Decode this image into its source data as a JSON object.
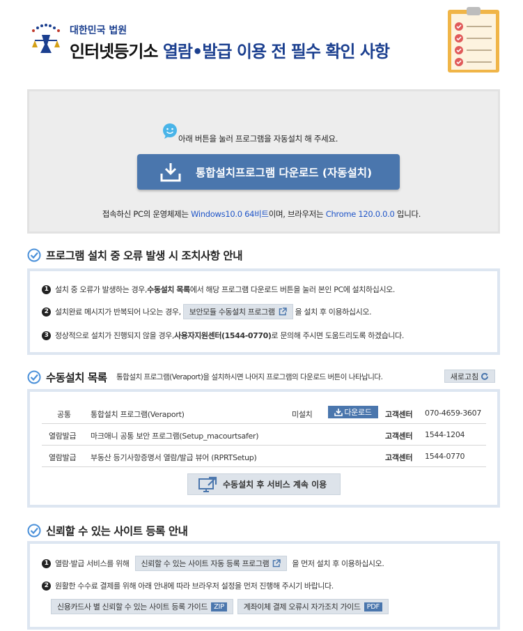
{
  "header": {
    "court": "대한민국 법원",
    "title_a": "인터넷등기소 ",
    "title_b": "열람•발급 이용 전 필수 확인 사항"
  },
  "install": {
    "hint": "아래 버튼을 눌러 프로그램을 자동설치 해 주세요.",
    "button": "통합설치프로그램 다운로드 (자동설치)",
    "os_a": "접속하신 PC의 운영체제는 ",
    "os": "Windows10.0 64비트",
    "os_b": "이며, 브라우저는 ",
    "browser": "Chrome 120.0.0.0",
    "os_c": " 입니다."
  },
  "errors": {
    "heading": "프로그램 설치 중 오류 발생 시 조치사항 안내",
    "s1_a": "설치 중 오류가 발생하는 경우, ",
    "s1_b": "수동설치 목록",
    "s1_c": "에서 해당 프로그램 다운로드 버튼을 눌러 본인 PC에 설치하십시오.",
    "s2_a": "설치완료 메시지가 반복되어 나오는 경우,",
    "s2_btn": "보안모듈 수동설치 프로그램",
    "s2_b": "을 설치 후 이용하십시오.",
    "s3_a": "정상적으로 설치가 진행되지 않을 경우, ",
    "s3_b": "사용자지원센터(1544-0770)",
    "s3_c": "로 문의해 주시면 도움드리도록 하겠습니다."
  },
  "manual": {
    "heading": "수동설치 목록",
    "note": "통합설치 프로그램(Veraport)을 설치하시면 나머지 프로그램의 다운로드 버튼이 나타납니다.",
    "refresh": "새로고침",
    "rows": [
      {
        "category": "공통",
        "name": "통합설치 프로그램(Veraport)",
        "status": "미설치",
        "download": "다운로드",
        "center": "고객센터",
        "phone": "070-4659-3607"
      },
      {
        "category": "열람발급",
        "name": "마크애니 공통 보안 프로그램(Setup_macourtsafer)",
        "status": "",
        "download": "",
        "center": "고객센터",
        "phone": "1544-1204"
      },
      {
        "category": "열람발급",
        "name": "부동산 등기사항증명서 열람/발급 뷰어 (RPRTSetup)",
        "status": "",
        "download": "",
        "center": "고객센터",
        "phone": "1544-0770"
      }
    ],
    "continue": "수동설치 후 서비스 계속 이용"
  },
  "trust": {
    "heading": "신뢰할 수 있는 사이트 등록 안내",
    "s1_a": "열람·발급 서비스를 위해",
    "s1_btn": "신뢰할 수 있는 사이트 자동 등록 프로그램",
    "s1_b": "을 먼저 설치 후 이용하십시오.",
    "s2": "원활한 수수료 결제를 위해 아래 안내에 따라 브라우저 설정을 먼저 진행해 주시기 바랍니다.",
    "guide1": "신용카드사 별 신뢰할 수 있는 사이트 등록 가이드",
    "guide1_tag": "ZIP",
    "guide2": "계좌이체 결제 오류시 자가조치 가이드",
    "guide2_tag": "PDF"
  },
  "colors": {
    "accent": "#4a76ad",
    "link": "#1f55c8",
    "panel_border": "#dde6f1"
  }
}
